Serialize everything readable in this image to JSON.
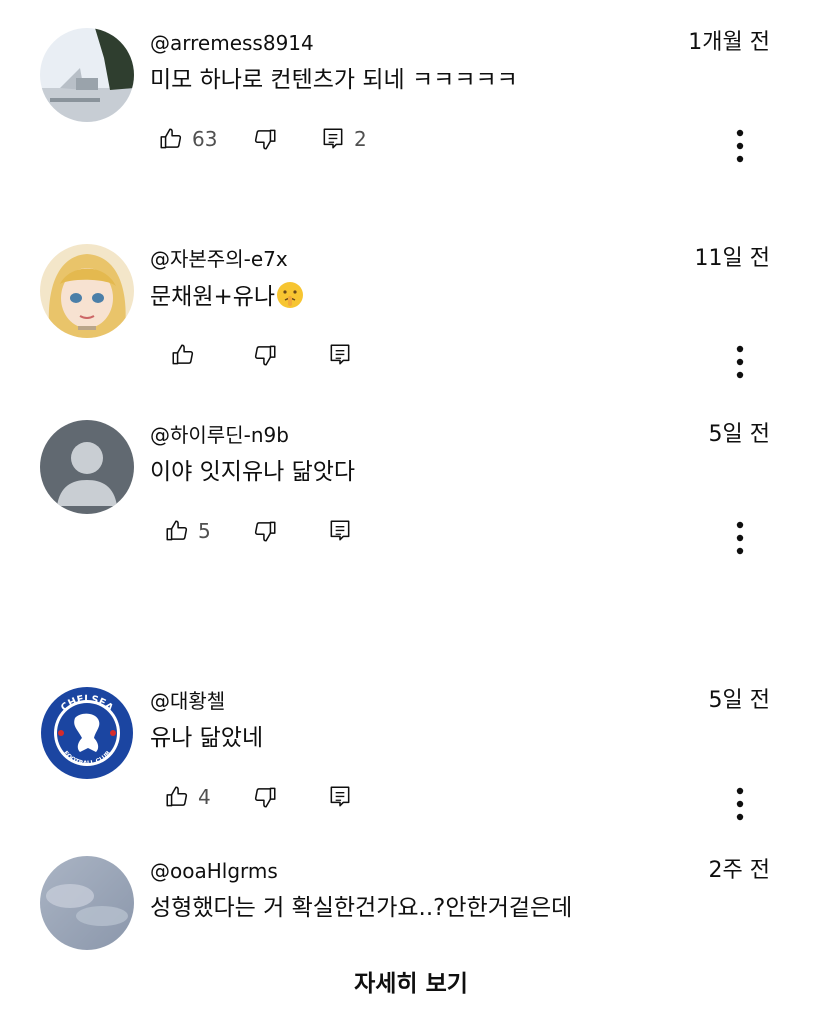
{
  "comments": [
    {
      "author": "@arremess8914",
      "time": "1개월 전",
      "text": "미모 하나로 컨텐츠가 되네 ㅋㅋㅋㅋㅋ",
      "likes": "63",
      "replies": "2"
    },
    {
      "author": "@자본주의-e7x",
      "time": "11일 전",
      "text": "문채원+유나",
      "likes": "",
      "replies": ""
    },
    {
      "author": "@하이루딘-n9b",
      "time": "5일 전",
      "text": "이야 잇지유나 닮앗다",
      "likes": "5",
      "replies": ""
    },
    {
      "author": "@대황첼",
      "time": "5일 전",
      "text": "유나 닮았네",
      "likes": "4",
      "replies": ""
    },
    {
      "author": "@ooaHlgrms",
      "time": "2주 전",
      "text": "성형했다는 거 확실한건가요..?안한거겉은데",
      "likes": "",
      "replies": ""
    }
  ],
  "badges": {
    "chelsea_logo_text": "CHELSEA FOOTBALL CLUB"
  },
  "icons": {
    "like": "thumbs-up-icon",
    "dislike": "thumbs-down-icon",
    "reply": "reply-icon",
    "more": "more-vert-icon",
    "emoji": "shushing-face-emoji"
  },
  "footer": {
    "see_more": "자세히 보기"
  },
  "colors": {
    "text": "#0f0f0f",
    "secondary": "#505050",
    "background": "#ffffff",
    "chelsea_blue": "#1b45a1"
  }
}
